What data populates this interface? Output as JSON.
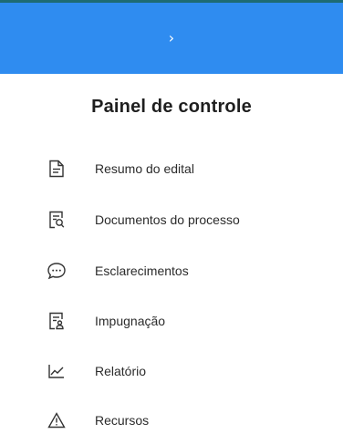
{
  "header": {
    "toggle_glyph": "›",
    "toggle_icon": "chevron-right-icon",
    "background": "#2f8cf0"
  },
  "panel": {
    "title": "Painel de controle"
  },
  "menu": {
    "items": [
      {
        "label": "Resumo do edital",
        "icon": "document-icon"
      },
      {
        "label": "Documentos do processo",
        "icon": "document-search-icon"
      },
      {
        "label": "Esclarecimentos",
        "icon": "chat-bubble-icon"
      },
      {
        "label": "Impugnação",
        "icon": "document-user-icon"
      },
      {
        "label": "Relatório",
        "icon": "line-chart-icon"
      },
      {
        "label": "Recursos",
        "icon": "warning-icon"
      }
    ]
  }
}
